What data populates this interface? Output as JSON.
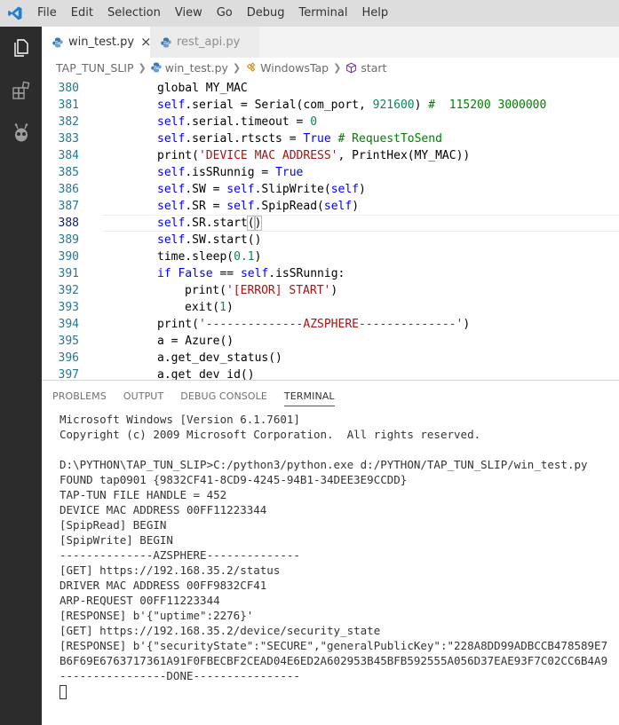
{
  "menu": [
    "File",
    "Edit",
    "Selection",
    "View",
    "Go",
    "Debug",
    "Terminal",
    "Help"
  ],
  "tabs": [
    {
      "label": "win_test.py",
      "active": true,
      "close": "×"
    },
    {
      "label": "rest_api.py",
      "active": false
    }
  ],
  "breadcrumbs": [
    "TAP_TUN_SLIP",
    "win_test.py",
    "WindowsTap",
    "start"
  ],
  "editor": {
    "current_line": 388,
    "lines": [
      {
        "n": "380",
        "segs": [
          [
            "t",
            "global MY_MAC"
          ]
        ]
      },
      {
        "n": "381",
        "segs": [
          [
            "k",
            "self"
          ],
          [
            "t",
            ".serial = Serial(com_port, "
          ],
          [
            "n",
            "921600"
          ],
          [
            "t",
            ") "
          ],
          [
            "c",
            "#  115200 3000000"
          ]
        ]
      },
      {
        "n": "382",
        "segs": [
          [
            "k",
            "self"
          ],
          [
            "t",
            ".serial.timeout = "
          ],
          [
            "n",
            "0"
          ]
        ]
      },
      {
        "n": "383",
        "segs": [
          [
            "k",
            "self"
          ],
          [
            "t",
            ".serial.rtscts = "
          ],
          [
            "k",
            "True"
          ],
          [
            "t",
            " "
          ],
          [
            "c",
            "# RequestToSend"
          ]
        ]
      },
      {
        "n": "384",
        "segs": [
          [
            "t",
            "print("
          ],
          [
            "s",
            "'DEVICE MAC ADDRESS'"
          ],
          [
            "t",
            ", PrintHex(MY_MAC))"
          ]
        ]
      },
      {
        "n": "385",
        "segs": [
          [
            "k",
            "self"
          ],
          [
            "t",
            ".isSRunnig = "
          ],
          [
            "k",
            "True"
          ]
        ]
      },
      {
        "n": "386",
        "segs": [
          [
            "k",
            "self"
          ],
          [
            "t",
            ".SW = "
          ],
          [
            "k",
            "self"
          ],
          [
            "t",
            ".SlipWrite("
          ],
          [
            "k",
            "self"
          ],
          [
            "t",
            ")"
          ]
        ]
      },
      {
        "n": "387",
        "segs": [
          [
            "k",
            "self"
          ],
          [
            "t",
            ".SR = "
          ],
          [
            "k",
            "self"
          ],
          [
            "t",
            ".SpipRead("
          ],
          [
            "k",
            "self"
          ],
          [
            "t",
            ")"
          ]
        ]
      },
      {
        "n": "388",
        "segs": [
          [
            "k",
            "self"
          ],
          [
            "t",
            ".SR.start"
          ],
          [
            "b",
            "("
          ],
          [
            "b",
            ")"
          ]
        ]
      },
      {
        "n": "389",
        "segs": [
          [
            "k",
            "self"
          ],
          [
            "t",
            ".SW.start()"
          ]
        ]
      },
      {
        "n": "390",
        "segs": [
          [
            "t",
            "time.sleep("
          ],
          [
            "n",
            "0.1"
          ],
          [
            "t",
            ")"
          ]
        ]
      },
      {
        "n": "391",
        "segs": [
          [
            "k",
            "if"
          ],
          [
            "t",
            " "
          ],
          [
            "k",
            "False"
          ],
          [
            "t",
            " == "
          ],
          [
            "k",
            "self"
          ],
          [
            "t",
            ".isSRunnig:"
          ]
        ]
      },
      {
        "n": "392",
        "indent": 1,
        "segs": [
          [
            "t",
            "print("
          ],
          [
            "s",
            "'[ERROR] START'"
          ],
          [
            "t",
            ")"
          ]
        ]
      },
      {
        "n": "393",
        "indent": 1,
        "segs": [
          [
            "t",
            "exit("
          ],
          [
            "n",
            "1"
          ],
          [
            "t",
            ")"
          ]
        ]
      },
      {
        "n": "394",
        "segs": [
          [
            "t",
            "print("
          ],
          [
            "s",
            "'--------------AZSPHERE--------------'"
          ],
          [
            "t",
            ")"
          ]
        ]
      },
      {
        "n": "395",
        "segs": [
          [
            "t",
            "a = Azure()"
          ]
        ]
      },
      {
        "n": "396",
        "segs": [
          [
            "t",
            "a.get_dev_status()"
          ]
        ]
      },
      {
        "n": "397",
        "segs": [
          [
            "t",
            "a.get_dev_id()"
          ]
        ]
      }
    ]
  },
  "panel": {
    "tabs": [
      "PROBLEMS",
      "OUTPUT",
      "DEBUG CONSOLE",
      "TERMINAL"
    ],
    "active_tab": "TERMINAL",
    "terminal_lines": [
      "Microsoft Windows [Version 6.1.7601]",
      "Copyright (c) 2009 Microsoft Corporation.  All rights reserved.",
      "",
      "D:\\PYTHON\\TAP_TUN_SLIP>C:/python3/python.exe d:/PYTHON/TAP_TUN_SLIP/win_test.py",
      "FOUND tap0901 {9832CF41-8CD9-4245-94B1-34DEE3E9CCDD}",
      "TAP-TUN FILE HANDLE = 452",
      "DEVICE MAC ADDRESS 00FF11223344",
      "[SpipRead] BEGIN",
      "[SpipWrite] BEGIN",
      "--------------AZSPHERE--------------",
      "[GET] https://192.168.35.2/status",
      "DRIVER MAC ADDRESS 00FF9832CF41",
      "ARP-REQUEST 00FF11223344",
      "[RESPONSE] b'{\"uptime\":2276}'",
      "[GET] https://192.168.35.2/device/security_state",
      "[RESPONSE] b'{\"securityState\":\"SECURE\",\"generalPublicKey\":\"228A8DD99ADBCCB478589E7",
      "B6F69E6763717361A91F0FBECBF2CEAD04E6ED2A602953B45BFB592555A056D37EAE93F7C02CC6B4A9",
      "----------------DONE----------------"
    ]
  },
  "colors": {
    "accent": "#007acc",
    "activity_bar": "#2c2c2c",
    "keyword": "#0000ff",
    "string": "#a31515",
    "number": "#098658",
    "comment": "#008000",
    "line_number": "#237893"
  },
  "icons": [
    "vscode-logo-icon",
    "explorer-icon",
    "extensions-icon",
    "alien-icon",
    "python-file-icon",
    "symbol-class-icon",
    "symbol-method-icon",
    "chevron-right-icon",
    "close-icon"
  ]
}
